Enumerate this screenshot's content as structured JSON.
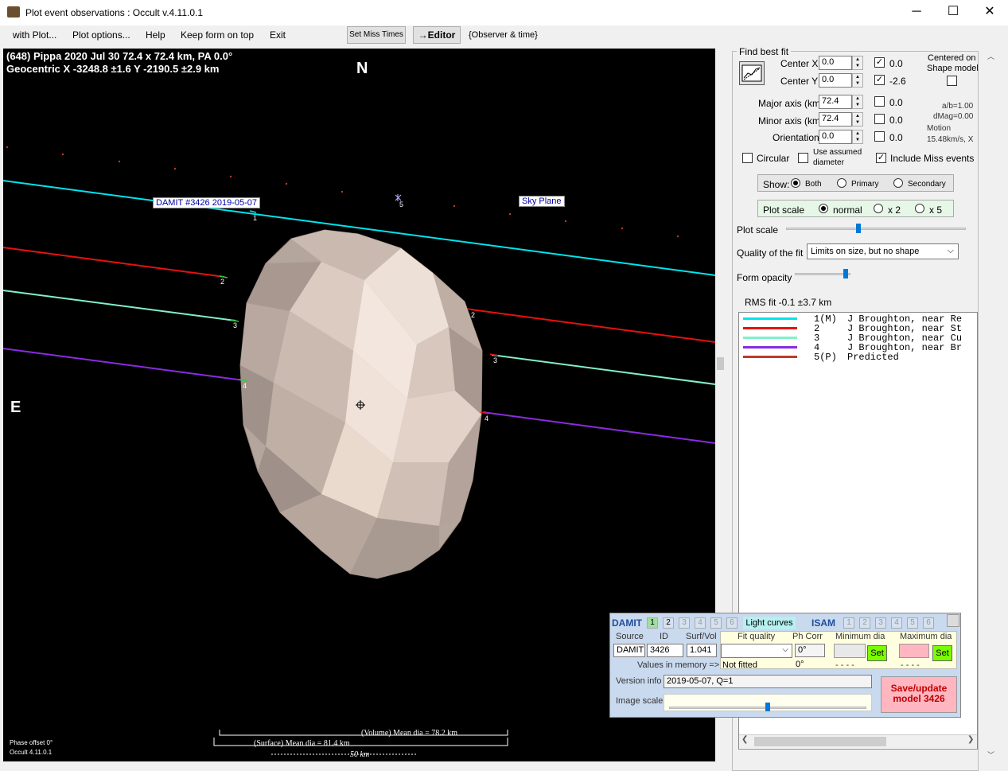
{
  "window": {
    "title": "Plot event observations : Occult v.4.11.0.1",
    "minimize": "─",
    "maximize": "☐",
    "close": "✕"
  },
  "menu": {
    "with_plot": "with Plot...",
    "plot_options": "Plot options...",
    "help": "Help",
    "keep_on_top": "Keep form on top",
    "exit": "Exit",
    "set_miss_times": "Set Miss Times",
    "editor": "→Editor",
    "observer_time": "{Observer & time}"
  },
  "plot": {
    "header_line1": "(648) Pippa  2020 Jul 30   72.4 x 72.4 km,  PA 0.0°",
    "header_line2": "Geocentric  X  -3248.8 ±1.6  Y -2190.5 ±2.9 km",
    "north": "N",
    "east": "E",
    "damit_label": "DAMIT #3426 2019-05-07",
    "sky_plane": "Sky Plane",
    "chord_labels": [
      "1",
      "2",
      "3",
      "4",
      "5",
      "2",
      "3",
      "4"
    ],
    "volume_dia": "(Volume) Mean dia = 78.2 km",
    "surface_dia": "(Surface) Mean dia = 81.4 km",
    "scale": "50 km",
    "phase_offset": "Phase offset 0°",
    "version": "Occult 4.11.0.1",
    "colors": {
      "chord1": "#00e5ee",
      "chord2": "#e81010",
      "chord3": "#80f0c8",
      "chord4": "#8a2be2",
      "predicted": "#c0392b"
    }
  },
  "fit": {
    "find_best_fit": "Find best fit",
    "center_x_label": "Center X",
    "center_x": "0.0",
    "center_x_chk": "0.0",
    "center_y_label": "Center Y",
    "center_y": "0.0",
    "center_y_chk": "-2.6",
    "major_label": "Major axis (km)",
    "major": "72.4",
    "major_chk": "0.0",
    "minor_label": "Minor axis (km)",
    "minor": "72.4",
    "minor_chk": "0.0",
    "orient_label": "Orientation",
    "orient": "0.0",
    "orient_chk": "0.0",
    "centered_on": "Centered on",
    "shape_model": "Shape model",
    "ab": "a/b=1.00",
    "dmag": "dMag=0.00",
    "motion": "Motion",
    "motion_val": "15.48km/s, X",
    "circular": "Circular",
    "use_assumed": "Use assumed",
    "diameter": "diameter",
    "include_miss": "Include Miss events",
    "show": "Show:",
    "both": "Both",
    "primary": "Primary",
    "secondary": "Secondary",
    "plot_scale_grp": "Plot scale",
    "normal": "normal",
    "x2": "x 2",
    "x5": "x 5",
    "plot_scale": "Plot scale",
    "quality": "Quality of the fit",
    "quality_value": "Limits on size, but no shape",
    "form_opacity": "Form opacity",
    "rms": "RMS fit -0.1 ±3.7 km",
    "legend": [
      {
        "id": "1(M)",
        "name": "J Broughton, near Re",
        "color": "#00e5ee"
      },
      {
        "id": "2",
        "name": "J Broughton, near St",
        "color": "#e81010"
      },
      {
        "id": "3",
        "name": "J Broughton, near Cu",
        "color": "#80f0c8"
      },
      {
        "id": "4",
        "name": "J Broughton, near Br",
        "color": "#8a2be2"
      },
      {
        "id": "5(P)",
        "name": "Predicted",
        "color": "#c0392b"
      }
    ]
  },
  "damit": {
    "damit": "DAMIT",
    "light_curves": "Light curves",
    "isam": "ISAM",
    "nums": [
      "1",
      "2",
      "3",
      "4",
      "5",
      "6"
    ],
    "source_lbl": "Source",
    "id_lbl": "ID",
    "surf_lbl": "Surf/Vol",
    "source": "DAMIT",
    "id": "3426",
    "surf": "1.041",
    "fit_quality": "Fit quality",
    "ph_corr": "Ph Corr",
    "min_dia": "Minimum dia",
    "max_dia": "Maximum dia",
    "ph_val": "0°",
    "values_in_memory": "Values in memory =>",
    "not_fitted": "Not fitted",
    "ph_mem": "0°",
    "dash1": "- - - -",
    "dash2": "- - - -",
    "set": "Set",
    "version_lbl": "Version info",
    "version": "2019-05-07, Q=1",
    "image_scale": "Image scale",
    "save": "Save/update model 3426"
  }
}
